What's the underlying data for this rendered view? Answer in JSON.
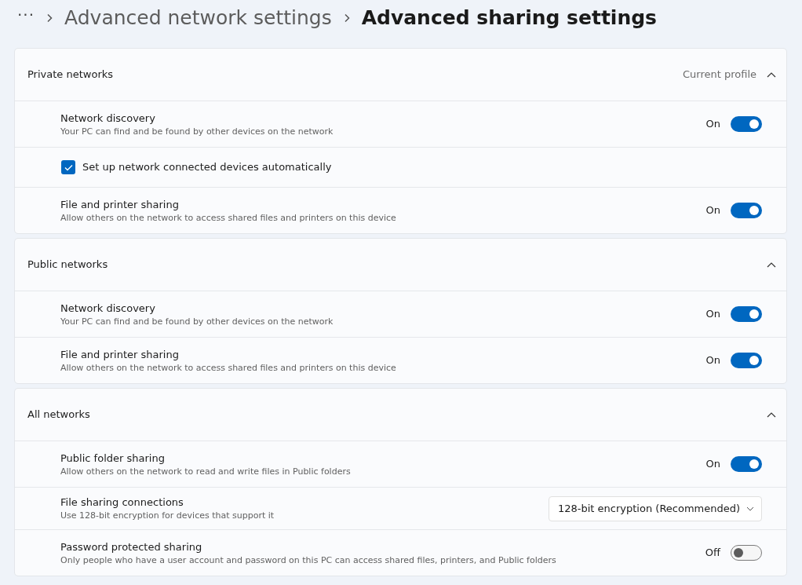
{
  "breadcrumb": {
    "more": "···",
    "items": [
      {
        "label": "Advanced network settings",
        "current": false
      },
      {
        "label": "Advanced sharing settings",
        "current": true
      }
    ]
  },
  "sections": [
    {
      "title": "Private networks",
      "note": "Current profile",
      "expanded": true,
      "rows": [
        {
          "kind": "toggle",
          "label": "Network discovery",
          "description": "Your PC can find and be found by other devices on the network",
          "on": true,
          "state_text": "On"
        },
        {
          "kind": "checkbox",
          "label": "Set up network connected devices automatically",
          "checked": true
        },
        {
          "kind": "toggle",
          "label": "File and printer sharing",
          "description": "Allow others on the network to access shared files and printers on this device",
          "on": true,
          "state_text": "On"
        }
      ]
    },
    {
      "title": "Public networks",
      "expanded": true,
      "rows": [
        {
          "kind": "toggle",
          "label": "Network discovery",
          "description": "Your PC can find and be found by other devices on the network",
          "on": true,
          "state_text": "On"
        },
        {
          "kind": "toggle",
          "label": "File and printer sharing",
          "description": "Allow others on the network to access shared files and printers on this device",
          "on": true,
          "state_text": "On"
        }
      ]
    },
    {
      "title": "All networks",
      "expanded": true,
      "rows": [
        {
          "kind": "toggle",
          "label": "Public folder sharing",
          "description": "Allow others on the network to read and write files in Public folders",
          "on": true,
          "state_text": "On"
        },
        {
          "kind": "dropdown",
          "label": "File sharing connections",
          "description": "Use 128-bit encryption for devices that support it",
          "value": "128-bit encryption (Recommended)"
        },
        {
          "kind": "toggle",
          "label": "Password protected sharing",
          "description": "Only people who have a user account and password on this PC can access shared files, printers, and Public folders",
          "on": false,
          "state_text": "Off"
        }
      ]
    }
  ]
}
